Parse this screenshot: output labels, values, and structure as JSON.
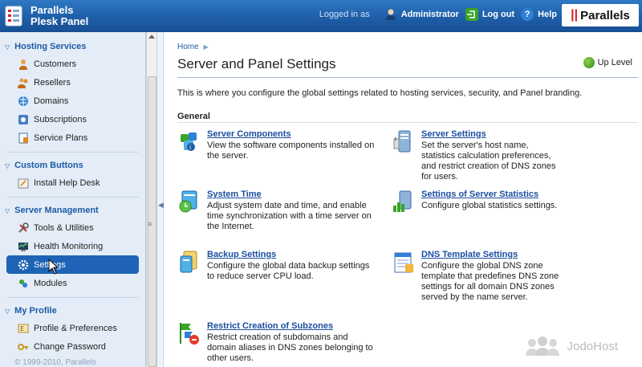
{
  "header": {
    "logo_line1": "Parallels",
    "logo_line2": "Plesk Panel",
    "logged_in_as": "Logged in as",
    "user": "Administrator",
    "logout": "Log out",
    "help": "Help",
    "brand": "Parallels"
  },
  "sidebar": {
    "groups": [
      {
        "title": "Hosting Services",
        "items": [
          "Customers",
          "Resellers",
          "Domains",
          "Subscriptions",
          "Service Plans"
        ]
      },
      {
        "title": "Custom Buttons",
        "items": [
          "Install Help Desk"
        ]
      },
      {
        "title": "Server Management",
        "items": [
          "Tools & Utilities",
          "Health Monitoring",
          "Settings",
          "Modules"
        ]
      },
      {
        "title": "My Profile",
        "items": [
          "Profile & Preferences",
          "Change Password"
        ]
      }
    ],
    "footer": "© 1999-2010, Parallels"
  },
  "main": {
    "breadcrumb": "Home",
    "title": "Server and Panel Settings",
    "up_level": "Up Level",
    "intro": "This is where you configure the global settings related to hosting services, security, and Panel branding.",
    "section": "General",
    "tools": [
      {
        "name": "Server Components",
        "desc": "View the software components installed on the server."
      },
      {
        "name": "Server Settings",
        "desc": "Set the server's host name, statistics calculation preferences, and restrict creation of DNS zones for users."
      },
      {
        "name": "System Time",
        "desc": "Adjust system date and time, and enable time synchronization with a time server on the Internet."
      },
      {
        "name": "Settings of Server Statistics",
        "desc": "Configure global statistics settings."
      },
      {
        "name": "Backup Settings",
        "desc": "Configure the global data backup settings to reduce server CPU load."
      },
      {
        "name": "DNS Template Settings",
        "desc": "Configure the global DNS zone template that predefines DNS zone settings for all domain DNS zones served by the name server."
      },
      {
        "name": "Restrict Creation of Subzones",
        "desc": "Restrict creation of subdomains and domain aliases in DNS zones belonging to other users."
      }
    ]
  },
  "watermark": "JodoHost",
  "colors": {
    "accent": "#1e63b6",
    "link": "#1c4ea0",
    "brand_red": "#d4202a"
  }
}
